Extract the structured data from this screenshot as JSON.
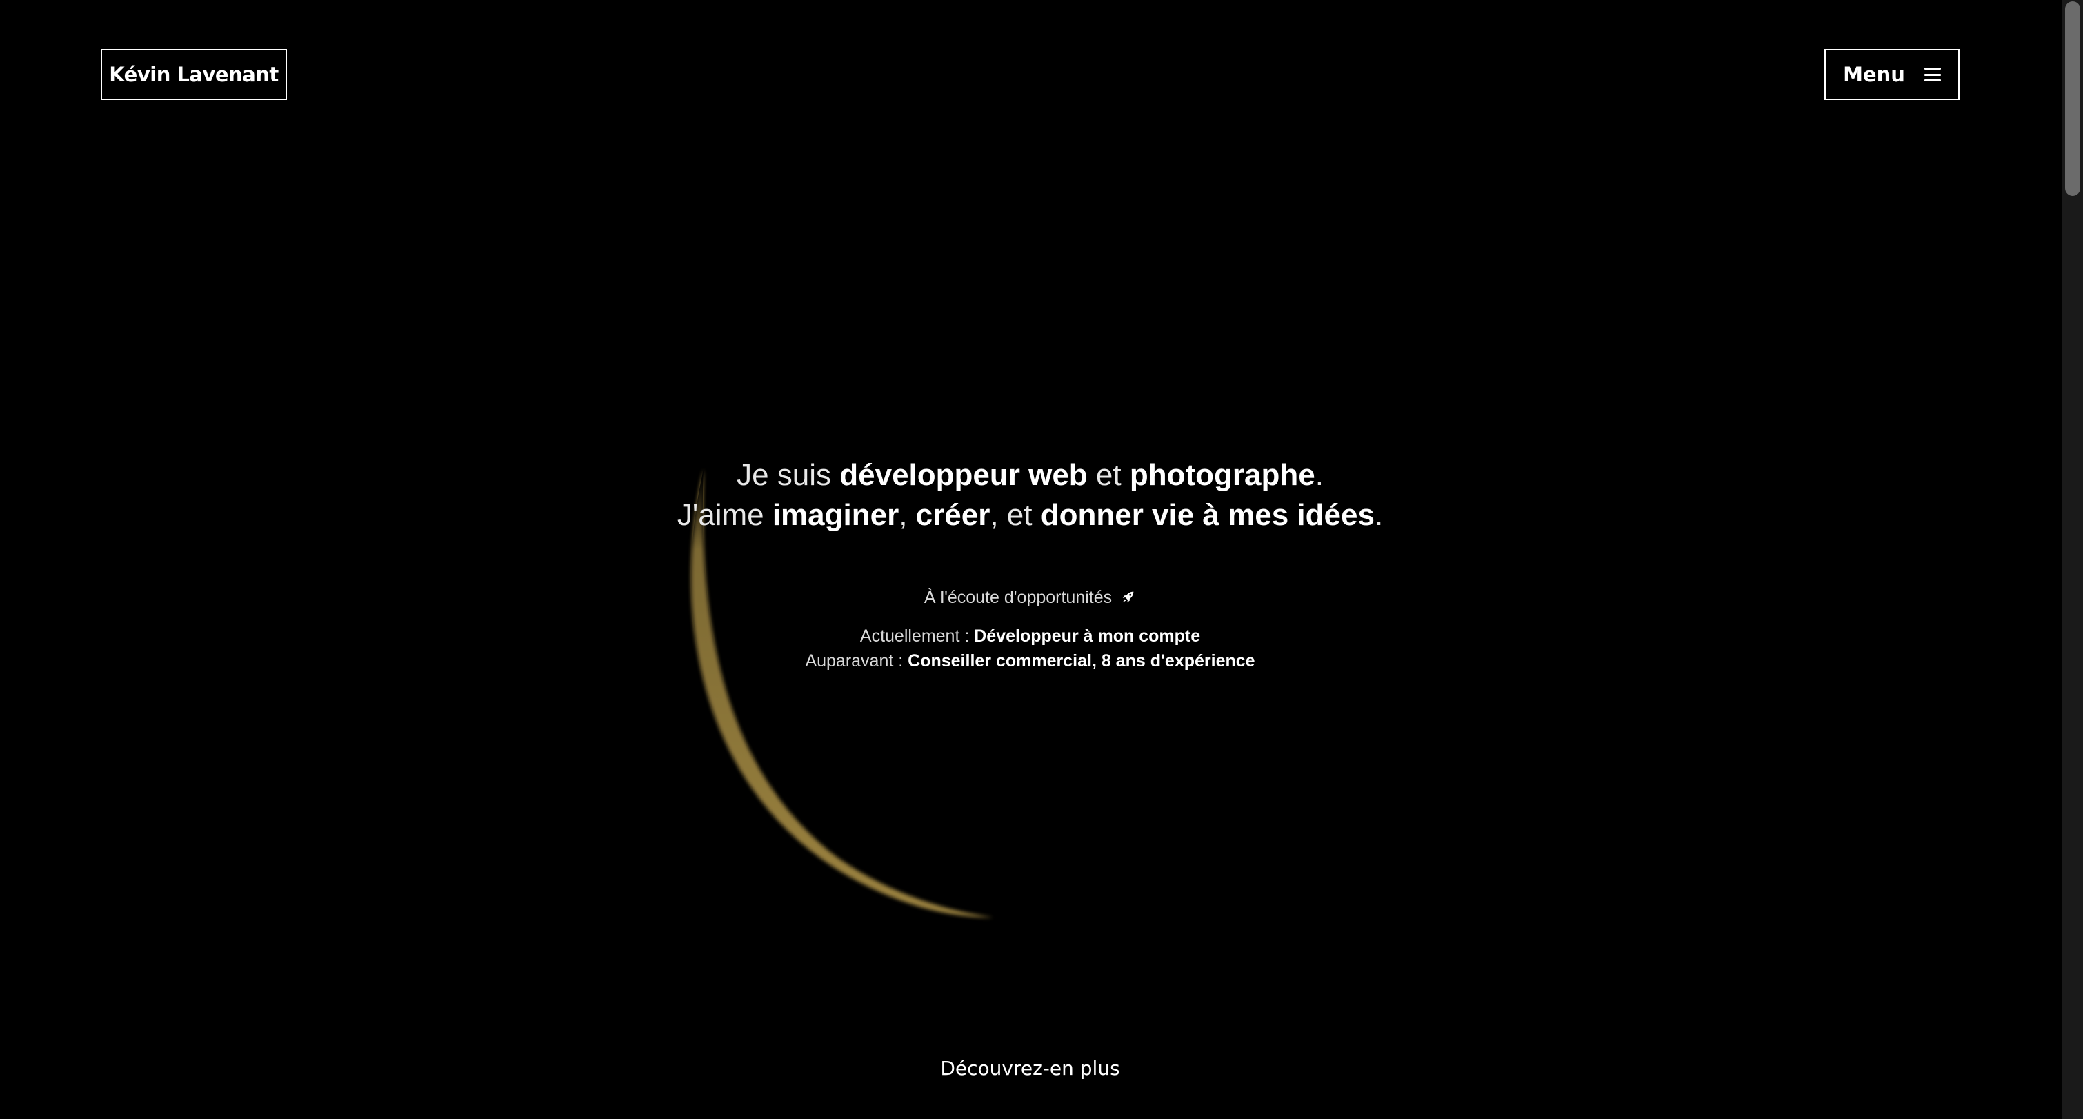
{
  "header": {
    "brand_label": "Kévin Lavenant",
    "menu_label": "Menu"
  },
  "hero": {
    "line1": {
      "p1": "Je suis ",
      "b1": "développeur web",
      "p2": " et ",
      "b2": "photographe",
      "p3": "."
    },
    "line2": {
      "p1": "J'aime ",
      "b1": "imaginer",
      "p2": ", ",
      "b2": "créer",
      "p3": ", et ",
      "b3": "donner vie à mes idées",
      "p4": "."
    },
    "availability": "À l'écoute d'opportunités",
    "current_label": "Actuellement : ",
    "current_value": "Développeur à mon compte",
    "previous_label": "Auparavant : ",
    "previous_value": "Conseiller commercial, 8 ans d'expérience"
  },
  "footer": {
    "discover_label": "Découvrez-en plus"
  },
  "colors": {
    "background": "#000000",
    "text": "#ffffff",
    "crescent_glow": "#c9a94e"
  },
  "icons": {
    "menu": "hamburger-icon",
    "availability": "rocket-icon"
  }
}
